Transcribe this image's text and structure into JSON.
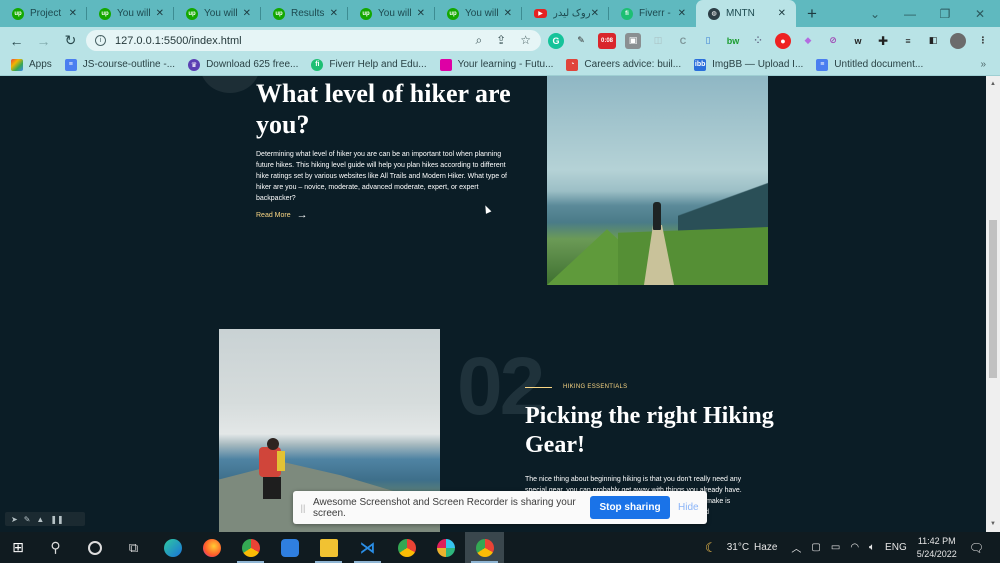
{
  "browser": {
    "tabs": [
      {
        "title": "Project",
        "favicon": "upwork-icon",
        "active": false
      },
      {
        "title": "You will",
        "favicon": "upwork-icon",
        "active": false
      },
      {
        "title": "You will",
        "favicon": "upwork-icon",
        "active": false
      },
      {
        "title": "Results",
        "favicon": "upwork-icon",
        "active": false
      },
      {
        "title": "You will",
        "favicon": "upwork-icon",
        "active": false
      },
      {
        "title": "You will",
        "favicon": "upwork-icon",
        "active": false
      },
      {
        "title": "روک لیدر",
        "favicon": "youtube-icon",
        "active": false
      },
      {
        "title": "Fiverr -",
        "favicon": "fiverr-icon",
        "active": false
      },
      {
        "title": "MNTN",
        "favicon": "globe-icon",
        "active": true
      }
    ],
    "new_tab_label": "+",
    "url": "127.0.0.1:5500/index.html",
    "extension_badge": "0:08",
    "bookmarks": [
      {
        "label": "Apps",
        "icon": "apps-grid-icon",
        "color": "#e8453c"
      },
      {
        "label": "JS-course-outline -...",
        "icon": "docs-icon",
        "color": "#4a7ef0"
      },
      {
        "label": "Download 625 free...",
        "icon": "crown-icon",
        "color": "#5b3fb3"
      },
      {
        "label": "Fiverr Help and Edu...",
        "icon": "fiverr-icon",
        "color": "#1dbf73"
      },
      {
        "label": "Your learning - Futu...",
        "icon": "futurelearn-icon",
        "color": "#de00a5"
      },
      {
        "label": "Careers advice: buil...",
        "icon": "careers-icon",
        "color": "#e0443a"
      },
      {
        "label": "ImgBB — Upload I...",
        "icon": "imgbb-icon",
        "color": "#2a6fdb"
      },
      {
        "label": "Untitled document...",
        "icon": "docs-icon",
        "color": "#4a7ef0"
      }
    ],
    "bookmarks_more": "»"
  },
  "page": {
    "section1": {
      "heading": "What level of hiker are you?",
      "body": "Determining what level of hiker you are can be an important tool when planning future hikes. This hiking level guide will help you plan hikes according to different hike ratings set by various websites like All Trails and Modern Hiker. What type of hiker are you – novice, moderate, advanced moderate, expert, or expert backpacker?",
      "read_more": "Read More",
      "arrow": "→"
    },
    "section2": {
      "number": "02",
      "eyebrow": "HIKING ESSENTIALS",
      "heading": "Picking the right Hiking Gear!",
      "body": "The nice thing about beginning hiking is that you don't really need any special gear, you can probably get away with things you already have. Let's start with clothing. A typical mistake hiking beginners make is wearing jeans and regular clothes, which will get heavy and"
    },
    "colors": {
      "background": "#0b1d26",
      "accent": "#fbd784",
      "text": "#ffffff"
    }
  },
  "share_notice": {
    "message": "Awesome Screenshot and Screen Recorder is sharing your screen.",
    "stop_label": "Stop sharing",
    "hide_label": "Hide",
    "grip": "||"
  },
  "taskbar": {
    "weather_temp": "31°C",
    "weather_desc": "Haze",
    "language": "ENG",
    "time": "11:42 PM",
    "date": "5/24/2022"
  }
}
